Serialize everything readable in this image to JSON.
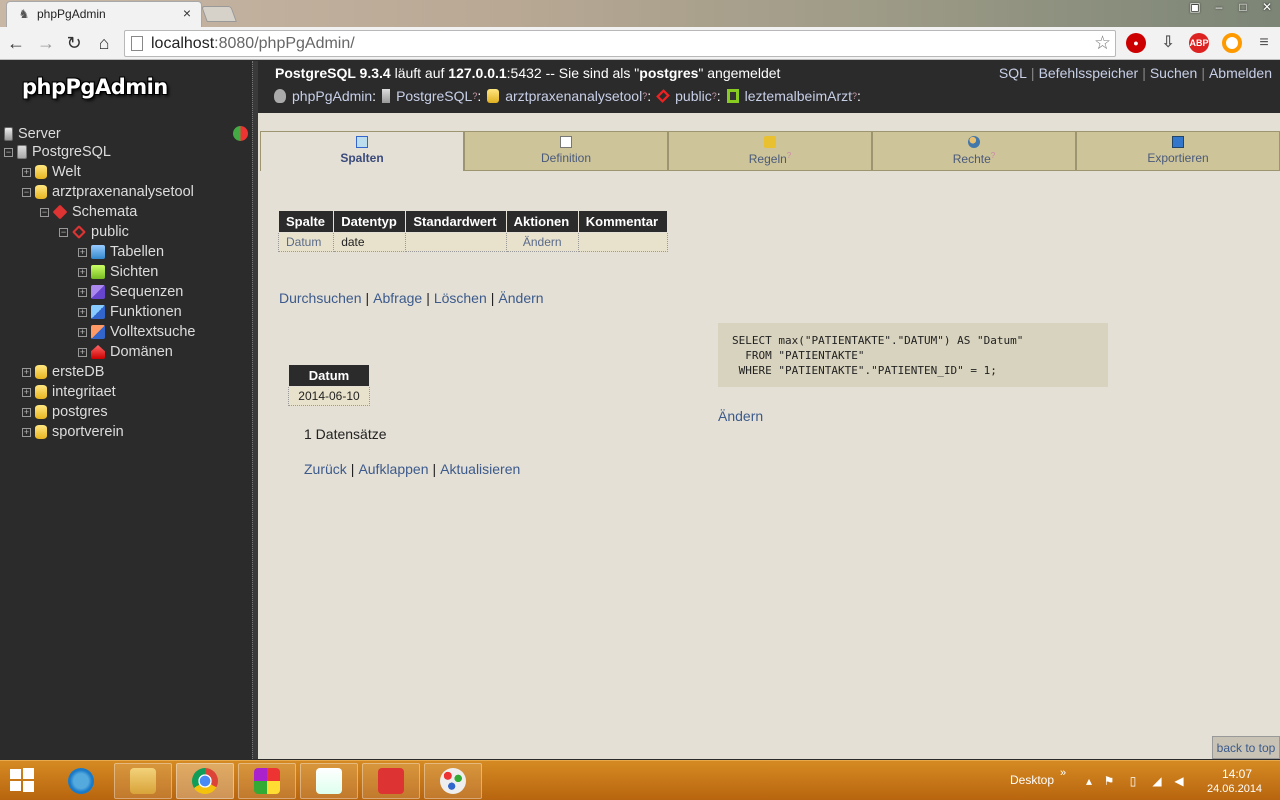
{
  "browser": {
    "tab_title": "phpPgAdmin",
    "tab_close": "×",
    "url_host": "localhost",
    "url_rest": ":8080/phpPgAdmin/",
    "nav": {
      "back": "←",
      "forward": "→",
      "reload": "↻",
      "home": "⌂"
    },
    "star": "☆",
    "extensions": [
      "stop-icon",
      "download-icon",
      "adblock-icon",
      "opera-icon",
      "menu-icon"
    ],
    "ext_abp": "ABP"
  },
  "sidebar": {
    "logo": "phpPgAdmin",
    "tree": {
      "server": "Server",
      "postgresql": "PostgreSQL",
      "welt": "Welt",
      "arzt": "arztpraxenanalysetool",
      "schemata": "Schemata",
      "public": "public",
      "tabellen": "Tabellen",
      "sichten": "Sichten",
      "sequenzen": "Sequenzen",
      "funktionen": "Funktionen",
      "volltextsuche": "Volltextsuche",
      "domaenen": "Domänen",
      "erstedb": "ersteDB",
      "integritaet": "integritaet",
      "postgres": "postgres",
      "sportverein": "sportverein"
    }
  },
  "header": {
    "server_version": "PostgreSQL 9.3.4",
    "runs_on": " läuft auf ",
    "host": "127.0.0.1",
    "port_text": ":5432 -- Sie sind als \"",
    "user": "postgres",
    "logged_in": "\" angemeldet",
    "links": {
      "sql": "SQL",
      "history": "Befehlsspeicher",
      "search": "Suchen",
      "logout": "Abmelden"
    },
    "trail": {
      "app": "phpPgAdmin",
      "server": "PostgreSQL",
      "database": "arztpraxenanalysetool",
      "schema": "public",
      "view": "leztemalbeimArzt",
      "help": "?",
      "colon": ":"
    }
  },
  "tabs": [
    {
      "label": "Spalten"
    },
    {
      "label": "Definition"
    },
    {
      "label": "Regeln",
      "help": "?"
    },
    {
      "label": "Rechte",
      "help": "?"
    },
    {
      "label": "Exportieren"
    }
  ],
  "columns_table": {
    "headers": [
      "Spalte",
      "Datentyp",
      "Standardwert",
      "Aktionen",
      "Kommentar"
    ],
    "rows": [
      {
        "spalte": "Datum",
        "datentyp": "date",
        "standardwert": "",
        "aktion": "Ändern",
        "kommentar": ""
      }
    ]
  },
  "actions": {
    "browse": "Durchsuchen",
    "query": "Abfrage",
    "delete": "Löschen",
    "alter": "Ändern",
    "pipe": "|"
  },
  "sql": {
    "text": "SELECT max(\"PATIENTAKTE\".\"DATUM\") AS \"Datum\"\n  FROM \"PATIENTAKTE\"\n WHERE \"PATIENTAKTE\".\"PATIENTEN_ID\" = 1;",
    "edit": "Ändern"
  },
  "result": {
    "header": "Datum",
    "value": "2014-06-10",
    "count": "1 Datensätze"
  },
  "result_links": {
    "back": "Zurück",
    "expand": "Aufklappen",
    "refresh": "Aktualisieren"
  },
  "back_to_top": "back to top",
  "taskbar": {
    "apps": [
      "ie-icon",
      "explorer-icon",
      "chrome-icon",
      "office-icon",
      "notepad-icon",
      "music-icon",
      "paint-icon"
    ],
    "desktop": "Desktop",
    "chevron": "»",
    "time": "14:07",
    "date": "24.06.2014"
  }
}
